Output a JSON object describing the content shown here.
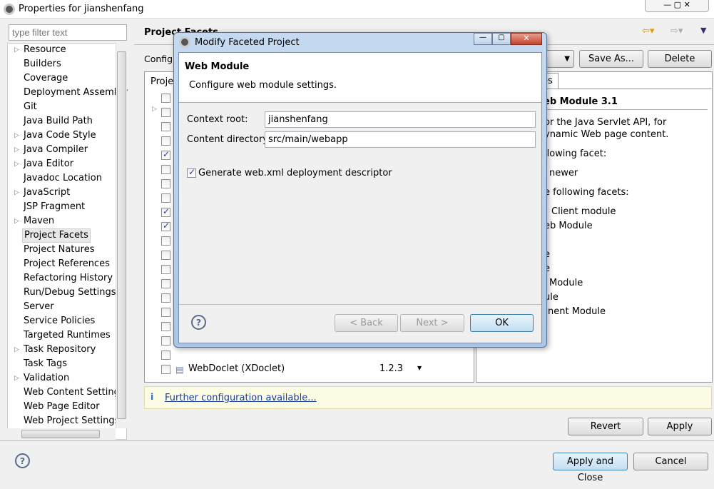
{
  "window": {
    "title": "Properties for jianshenfang"
  },
  "sidebar": {
    "filter_placeholder": "type filter text",
    "items": [
      {
        "label": "Resource",
        "expandable": true
      },
      {
        "label": "Builders"
      },
      {
        "label": "Coverage"
      },
      {
        "label": "Deployment Assembly"
      },
      {
        "label": "Git"
      },
      {
        "label": "Java Build Path"
      },
      {
        "label": "Java Code Style",
        "expandable": true
      },
      {
        "label": "Java Compiler",
        "expandable": true
      },
      {
        "label": "Java Editor",
        "expandable": true
      },
      {
        "label": "Javadoc Location"
      },
      {
        "label": "JavaScript",
        "expandable": true
      },
      {
        "label": "JSP Fragment"
      },
      {
        "label": "Maven",
        "expandable": true
      },
      {
        "label": "Project Facets",
        "selected": true
      },
      {
        "label": "Project Natures"
      },
      {
        "label": "Project References"
      },
      {
        "label": "Refactoring History"
      },
      {
        "label": "Run/Debug Settings"
      },
      {
        "label": "Server"
      },
      {
        "label": "Service Policies"
      },
      {
        "label": "Targeted Runtimes"
      },
      {
        "label": "Task Repository",
        "expandable": true
      },
      {
        "label": "Task Tags"
      },
      {
        "label": "Validation",
        "expandable": true
      },
      {
        "label": "Web Content Settings"
      },
      {
        "label": "Web Page Editor"
      },
      {
        "label": "Web Project Settings"
      }
    ]
  },
  "main": {
    "title": "Project Facets",
    "config_label": "Configu",
    "save_as": "Save As...",
    "delete": "Delete",
    "table_header": "Projec",
    "details_tab": "es",
    "facets": [
      false,
      false,
      false,
      false,
      true,
      false,
      false,
      false,
      true,
      true,
      false,
      false,
      false,
      false,
      false,
      false,
      false,
      false,
      false
    ],
    "last_facet": {
      "name": "WebDoclet (XDoclet)",
      "version": "1.2.3",
      "checked": false
    },
    "details": {
      "title": "eb Module 3.1",
      "lines": [
        "or the Java Servlet API, for",
        "ynamic Web page content.",
        "llowing facet:",
        "newer",
        "e following facets:",
        "Client module",
        "eb Module",
        "e",
        "e",
        "Module",
        "ule",
        "nent Module"
      ]
    },
    "info_link": "Further configuration available...",
    "revert": "Revert",
    "apply": "Apply"
  },
  "footer": {
    "apply_close": "Apply and Close",
    "cancel": "Cancel"
  },
  "dialog": {
    "title": "Modify Faceted Project",
    "heading": "Web Module",
    "description": "Configure web module settings.",
    "context_root_label": "Context root:",
    "context_root": "jianshenfang",
    "content_dir_label": "Content directory:",
    "content_dir": "src/main/webapp",
    "generate_label": "Generate web.xml deployment descriptor",
    "generate_checked": true,
    "back": "< Back",
    "next": "Next >",
    "ok": "OK"
  }
}
